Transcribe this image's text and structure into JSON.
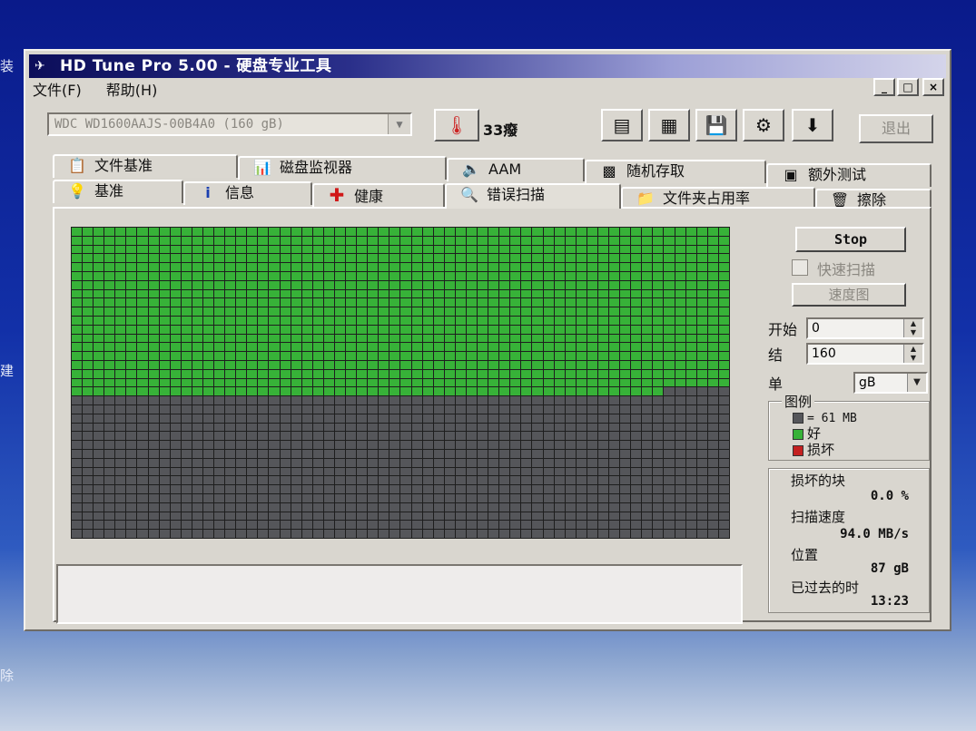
{
  "desktop": {
    "fragments": [
      "装",
      "建",
      "除"
    ]
  },
  "window": {
    "title": "HD Tune Pro 5.00 - 硬盘专业工具",
    "menu": [
      "文件(F)",
      "帮助(H)"
    ],
    "controls": {
      "minimize": "_",
      "maximize": "□",
      "close": "×"
    }
  },
  "toolbar": {
    "drive_select": "WDC WD1600AAJS-00B4A0 (160 gB)",
    "temperature": "33癈",
    "exit_label": "退出",
    "icons": [
      "copy-info-icon",
      "copy-screen-icon",
      "save-icon",
      "options-icon",
      "download-icon"
    ]
  },
  "tabs": {
    "row1": [
      "文件基准",
      "磁盘监视器",
      "AAM",
      "随机存取",
      "额外测试"
    ],
    "row2": [
      "基准",
      "信息",
      "健康",
      "错误扫描",
      "文件夹占用率",
      "擦除"
    ],
    "active": "错误扫描"
  },
  "scan": {
    "total_blocks": 2100,
    "scanned_fraction": 0.54,
    "damaged_blocks": 0,
    "colors": {
      "good": "#37b238",
      "unscanned": "#55565a",
      "bad": "#c42020"
    }
  },
  "controls": {
    "stop_label": "Stop",
    "quick_scan_label": "快速扫描",
    "speed_map_label": "速度图",
    "start_label": "开始",
    "start_value": "0",
    "end_label": "结",
    "end_value": "160",
    "unit_label": "单",
    "unit_value": "gB"
  },
  "legend": {
    "title": "图例",
    "block_size": "= 61 MB",
    "good": "好",
    "damaged": "损坏"
  },
  "stats": {
    "damaged_blocks_label": "损坏的块",
    "damaged_blocks_value": "0.0 %",
    "scan_speed_label": "扫描速度",
    "scan_speed_value": "94.0 MB/s",
    "position_label": "位置",
    "position_value": "87 gB",
    "elapsed_label": "已过去的时",
    "elapsed_value": "13:23"
  }
}
